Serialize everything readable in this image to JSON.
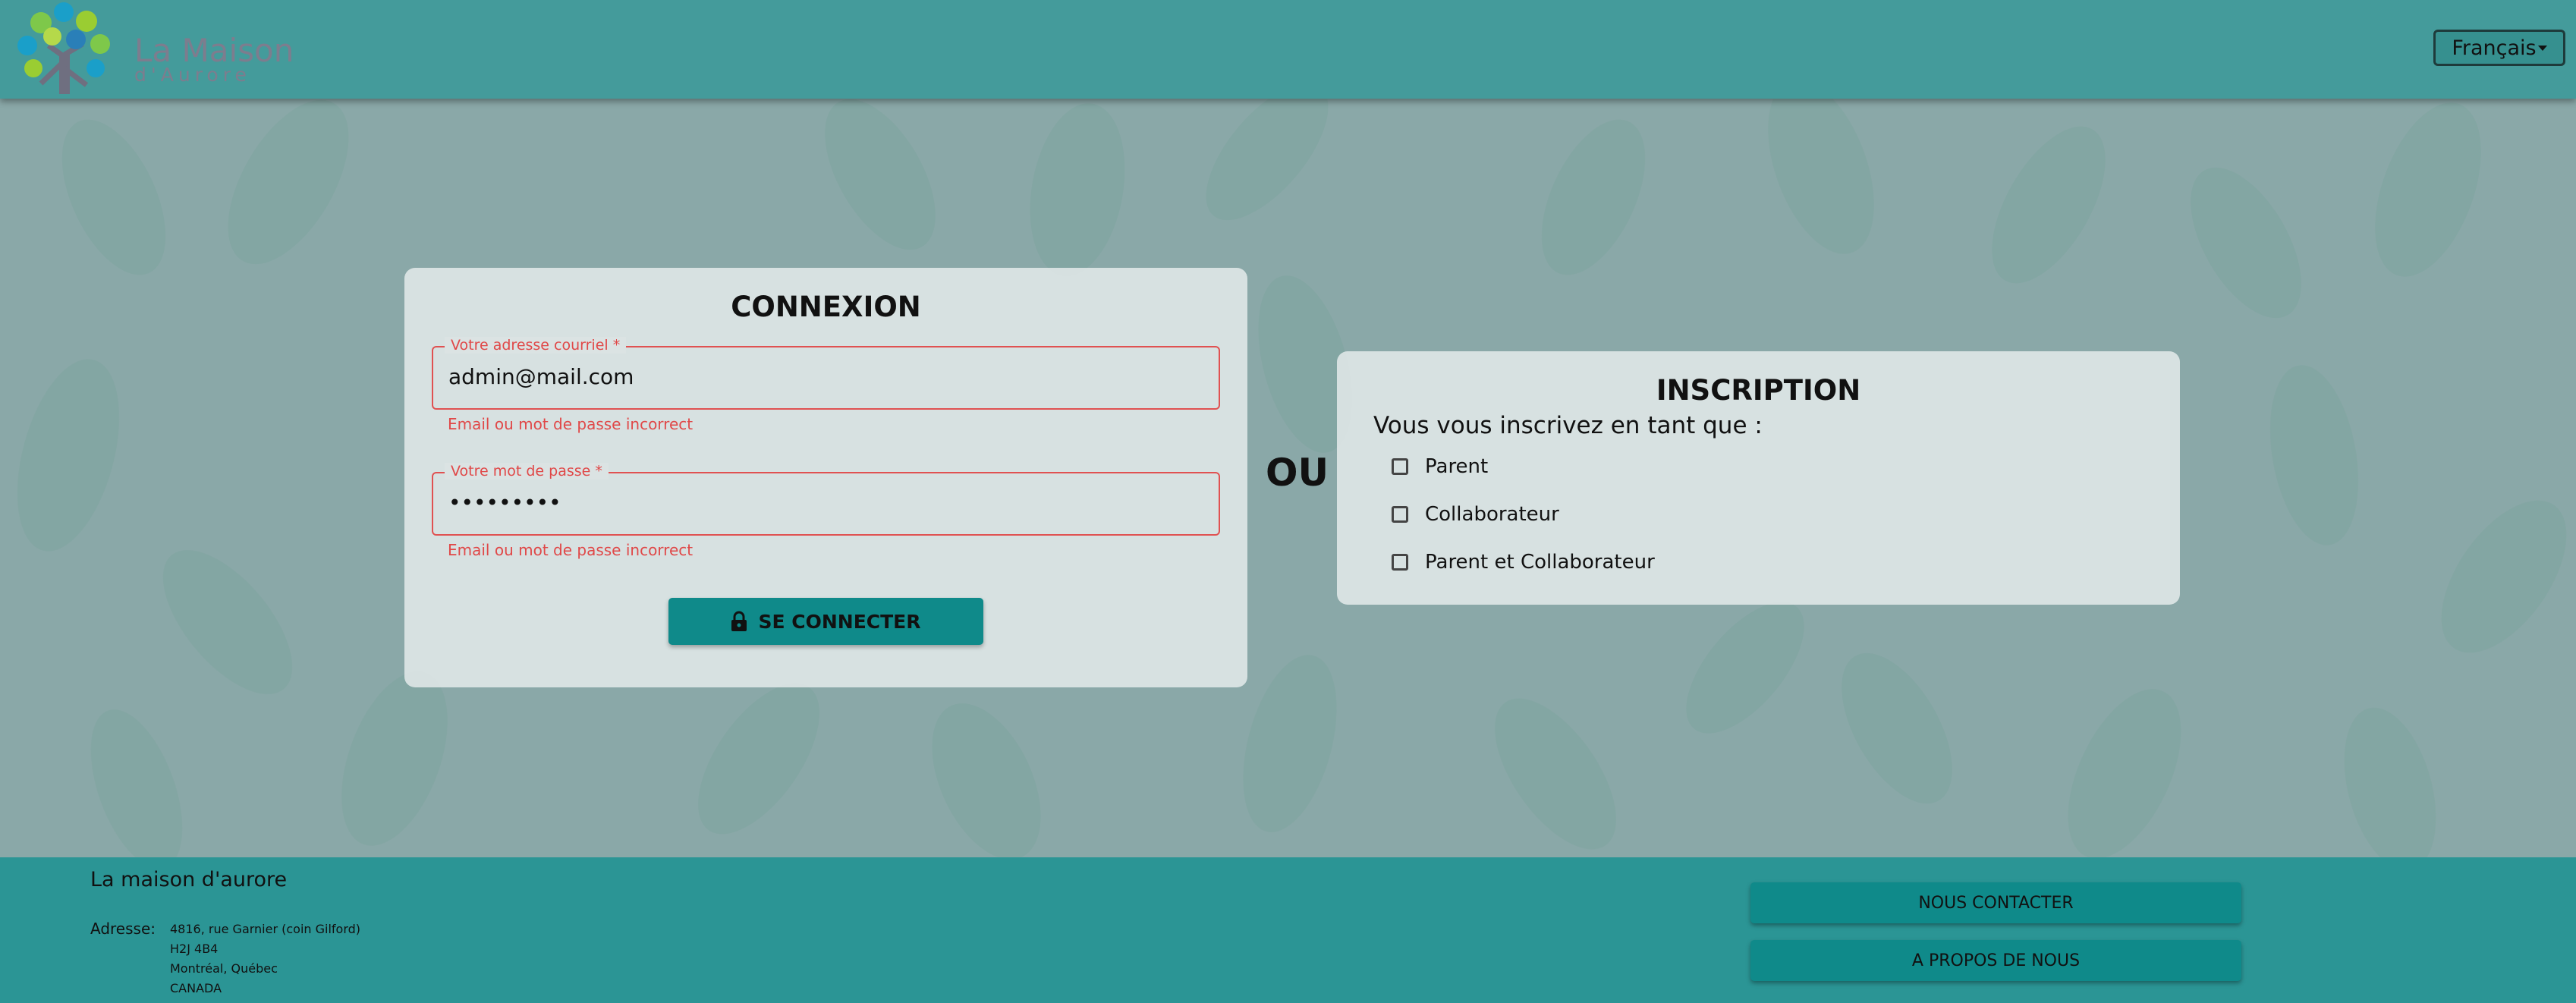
{
  "header": {
    "logo_line1": "La Maison",
    "logo_line2": "d'Aurore",
    "language": "Français"
  },
  "login": {
    "title": "CONNEXION",
    "email": {
      "label": "Votre adresse courriel *",
      "value": "admin@mail.com",
      "error": "Email ou mot de passe incorrect"
    },
    "password": {
      "label": "Votre mot de passe *",
      "value": "•••••••••",
      "error": "Email ou mot de passe incorrect"
    },
    "submit_label": "SE CONNECTER"
  },
  "separator": "OU",
  "signup": {
    "title": "INSCRIPTION",
    "subtitle": "Vous vous inscrivez en tant que :",
    "options": [
      "Parent",
      "Collaborateur",
      "Parent et Collaborateur"
    ]
  },
  "footer": {
    "title": "La maison d'aurore",
    "address_label": "Adresse:",
    "address_lines": [
      "4816, rue Garnier (coin Gilford)",
      "H2J 4B4",
      "Montréal, Québec",
      "CANADA"
    ],
    "contact_label": "NOUS CONTACTER",
    "about_label": "A PROPOS DE NOUS"
  },
  "colors": {
    "header": "#449b9b",
    "footer": "#2b9595",
    "primary_button": "#0f8a8a",
    "error": "#e04848",
    "page_background": "#8aa8a8"
  },
  "icons": {
    "login_button": "lock-icon",
    "logo": "tree-logo",
    "language_caret": "caret-down-icon"
  }
}
